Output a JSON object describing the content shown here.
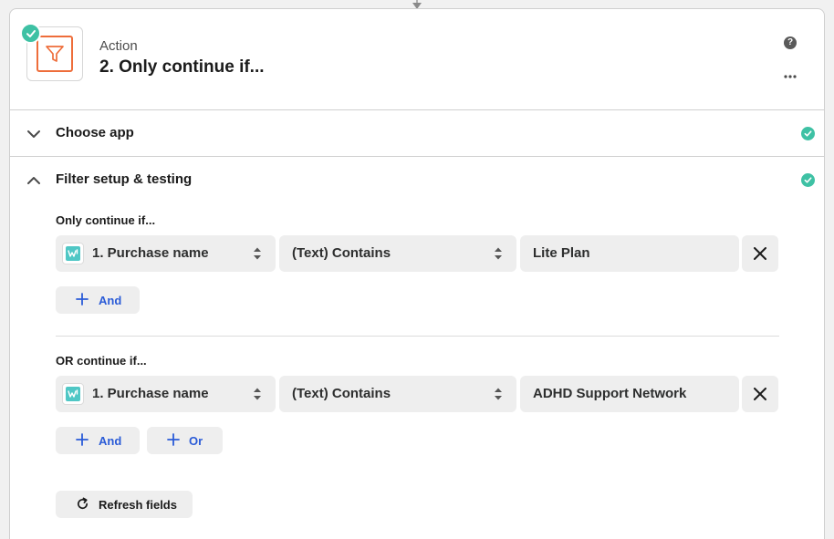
{
  "header": {
    "step_type": "Action",
    "step_title": "2. Only continue if...",
    "help_glyph": "?",
    "icons": {
      "app": "filter-icon",
      "status": "check-icon",
      "help": "help-icon",
      "more": "more-icon"
    },
    "colors": {
      "accent": "#ee6d3a",
      "success": "#3ec1a4"
    }
  },
  "sections": [
    {
      "label": "Choose app",
      "expanded": false,
      "complete": true
    },
    {
      "label": "Filter setup & testing",
      "expanded": true,
      "complete": true
    }
  ],
  "filter": {
    "groups": [
      {
        "label": "Only continue if...",
        "conditions": [
          {
            "field": "1. Purchase name",
            "operator": "(Text) Contains",
            "value": "Lite Plan"
          }
        ],
        "buttons": [
          {
            "label": "And",
            "icon": "plus-icon"
          }
        ]
      },
      {
        "label": "OR continue if...",
        "conditions": [
          {
            "field": "1. Purchase name",
            "operator": "(Text) Contains",
            "value": "ADHD Support Network"
          }
        ],
        "buttons": [
          {
            "label": "And",
            "icon": "plus-icon"
          },
          {
            "label": "Or",
            "icon": "plus-icon"
          }
        ]
      }
    ],
    "refresh_label": "Refresh fields",
    "colors": {
      "link": "#2a5bd7",
      "field_bg": "#eeeeee"
    }
  }
}
